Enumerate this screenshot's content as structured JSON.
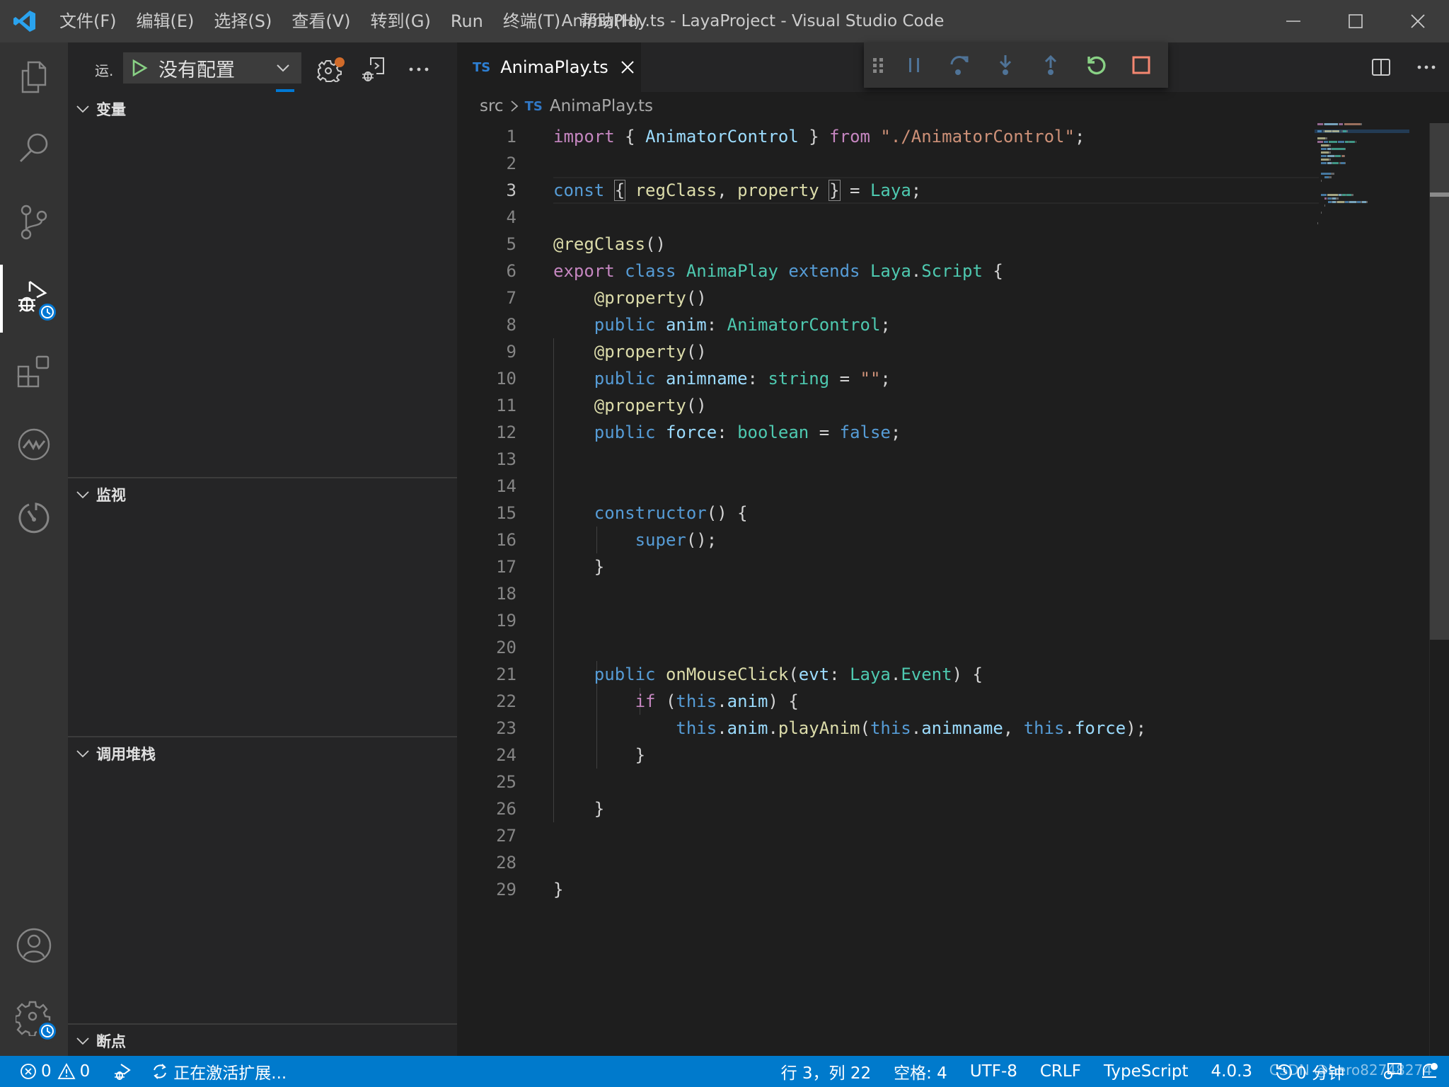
{
  "window": {
    "title": "AnimaPlay.ts - LayaProject - Visual Studio Code"
  },
  "menu": [
    "文件(F)",
    "编辑(E)",
    "选择(S)",
    "查看(V)",
    "转到(G)",
    "Run",
    "终端(T)",
    "帮助(H)"
  ],
  "activity_bar": {
    "items": [
      {
        "name": "explorer",
        "icon": "files-icon"
      },
      {
        "name": "search",
        "icon": "search-icon"
      },
      {
        "name": "source-control",
        "icon": "source-control-icon"
      },
      {
        "name": "run-debug",
        "icon": "debug-icon",
        "active": true,
        "badge": "clock-icon"
      },
      {
        "name": "extensions",
        "icon": "extensions-icon"
      },
      {
        "name": "aw",
        "icon": "aw-icon"
      },
      {
        "name": "timer",
        "icon": "timer-icon"
      }
    ],
    "bottom": [
      {
        "name": "accounts",
        "icon": "account-icon"
      },
      {
        "name": "manage",
        "icon": "gear-icon",
        "badge": "clock-icon"
      }
    ]
  },
  "sidebar": {
    "run_label": "运.",
    "config_select": "没有配置",
    "sections": [
      {
        "title": "变量"
      },
      {
        "title": "监视"
      },
      {
        "title": "调用堆栈"
      },
      {
        "title": "断点"
      }
    ]
  },
  "editor": {
    "tab": {
      "lang_badge": "TS",
      "filename": "AnimaPlay.ts"
    },
    "breadcrumb": {
      "folder": "src",
      "lang_badge": "TS",
      "file": "AnimaPlay.ts"
    },
    "current_line": 3,
    "lines": [
      [
        [
          "k",
          "import"
        ],
        [
          "pun",
          " { "
        ],
        [
          "var",
          "AnimatorControl"
        ],
        [
          "pun",
          " } "
        ],
        [
          "k",
          "from"
        ],
        [
          "pun",
          " "
        ],
        [
          "str",
          "\"./AnimatorControl\""
        ],
        [
          "pun",
          ";"
        ]
      ],
      [],
      [
        [
          "kw",
          "const"
        ],
        [
          "pun",
          " "
        ],
        [
          "box",
          "{"
        ],
        [
          "pun",
          " "
        ],
        [
          "fn",
          "regClass"
        ],
        [
          "pun",
          ", "
        ],
        [
          "fn",
          "property"
        ],
        [
          "pun",
          " "
        ],
        [
          "box",
          "}"
        ],
        [
          "pun",
          " = "
        ],
        [
          "ty",
          "Laya"
        ],
        [
          "pun",
          ";"
        ]
      ],
      [],
      [
        [
          "fn",
          "@regClass"
        ],
        [
          "pun",
          "()"
        ]
      ],
      [
        [
          "k",
          "export"
        ],
        [
          "pun",
          " "
        ],
        [
          "kw",
          "class"
        ],
        [
          "pun",
          " "
        ],
        [
          "ty",
          "AnimaPlay"
        ],
        [
          "pun",
          " "
        ],
        [
          "kw",
          "extends"
        ],
        [
          "pun",
          " "
        ],
        [
          "ty",
          "Laya"
        ],
        [
          "pun",
          "."
        ],
        [
          "ty",
          "Script"
        ],
        [
          "pun",
          " {"
        ]
      ],
      [
        [
          "pun",
          "    "
        ],
        [
          "fn",
          "@property"
        ],
        [
          "pun",
          "()"
        ]
      ],
      [
        [
          "pun",
          "    "
        ],
        [
          "kw",
          "public"
        ],
        [
          "pun",
          " "
        ],
        [
          "var",
          "anim"
        ],
        [
          "pun",
          ": "
        ],
        [
          "ty",
          "AnimatorControl"
        ],
        [
          "pun",
          ";"
        ]
      ],
      [
        [
          "pun",
          "    "
        ],
        [
          "fn",
          "@property"
        ],
        [
          "pun",
          "()"
        ]
      ],
      [
        [
          "pun",
          "    "
        ],
        [
          "kw",
          "public"
        ],
        [
          "pun",
          " "
        ],
        [
          "var",
          "animname"
        ],
        [
          "pun",
          ": "
        ],
        [
          "ty",
          "string"
        ],
        [
          "pun",
          " = "
        ],
        [
          "str",
          "\"\""
        ],
        [
          "pun",
          ";"
        ]
      ],
      [
        [
          "pun",
          "    "
        ],
        [
          "fn",
          "@property"
        ],
        [
          "pun",
          "()"
        ]
      ],
      [
        [
          "pun",
          "    "
        ],
        [
          "kw",
          "public"
        ],
        [
          "pun",
          " "
        ],
        [
          "var",
          "force"
        ],
        [
          "pun",
          ": "
        ],
        [
          "ty",
          "boolean"
        ],
        [
          "pun",
          " = "
        ],
        [
          "kw",
          "false"
        ],
        [
          "pun",
          ";"
        ]
      ],
      [],
      [],
      [
        [
          "pun",
          "    "
        ],
        [
          "kw",
          "constructor"
        ],
        [
          "pun",
          "() {"
        ]
      ],
      [
        [
          "pun",
          "        "
        ],
        [
          "kw",
          "super"
        ],
        [
          "pun",
          "();"
        ]
      ],
      [
        [
          "pun",
          "    }"
        ]
      ],
      [],
      [],
      [],
      [
        [
          "pun",
          "    "
        ],
        [
          "kw",
          "public"
        ],
        [
          "pun",
          " "
        ],
        [
          "fn",
          "onMouseClick"
        ],
        [
          "pun",
          "("
        ],
        [
          "prm",
          "evt"
        ],
        [
          "pun",
          ": "
        ],
        [
          "ty",
          "Laya"
        ],
        [
          "pun",
          "."
        ],
        [
          "ty",
          "Event"
        ],
        [
          "pun",
          ") {"
        ]
      ],
      [
        [
          "pun",
          "        "
        ],
        [
          "k",
          "if"
        ],
        [
          "pun",
          " ("
        ],
        [
          "kw",
          "this"
        ],
        [
          "pun",
          "."
        ],
        [
          "var",
          "anim"
        ],
        [
          "pun",
          ") {"
        ]
      ],
      [
        [
          "pun",
          "            "
        ],
        [
          "kw",
          "this"
        ],
        [
          "pun",
          "."
        ],
        [
          "var",
          "anim"
        ],
        [
          "pun",
          "."
        ],
        [
          "fn",
          "playAnim"
        ],
        [
          "pun",
          "("
        ],
        [
          "kw",
          "this"
        ],
        [
          "pun",
          "."
        ],
        [
          "var",
          "animname"
        ],
        [
          "pun",
          ", "
        ],
        [
          "kw",
          "this"
        ],
        [
          "pun",
          "."
        ],
        [
          "var",
          "force"
        ],
        [
          "pun",
          ");"
        ]
      ],
      [
        [
          "pun",
          "        }"
        ]
      ],
      [],
      [
        [
          "pun",
          "    }"
        ]
      ],
      [],
      [],
      [
        [
          "pun",
          "}"
        ]
      ]
    ]
  },
  "debug_toolbar": [
    "drag-grip",
    "pause",
    "step-over",
    "step-into",
    "step-out",
    "restart",
    "stop"
  ],
  "colors": {
    "accent": "#007acc",
    "restart": "#89d185",
    "stop": "#f48771",
    "debug_disabled": "#4f7397",
    "run_green": "#89d185",
    "gear_dot": "#d16b2a"
  },
  "statusbar": {
    "errors": "0",
    "warnings": "0",
    "activity": "正在激活扩展...",
    "cursor": "行 3，列 22",
    "indent": "空格: 4",
    "encoding": "UTF-8",
    "eol": "CRLF",
    "language": "TypeScript",
    "ts_version": "4.0.3",
    "time": "0 分钟",
    "watermark": "CSDN @hero82748274"
  }
}
